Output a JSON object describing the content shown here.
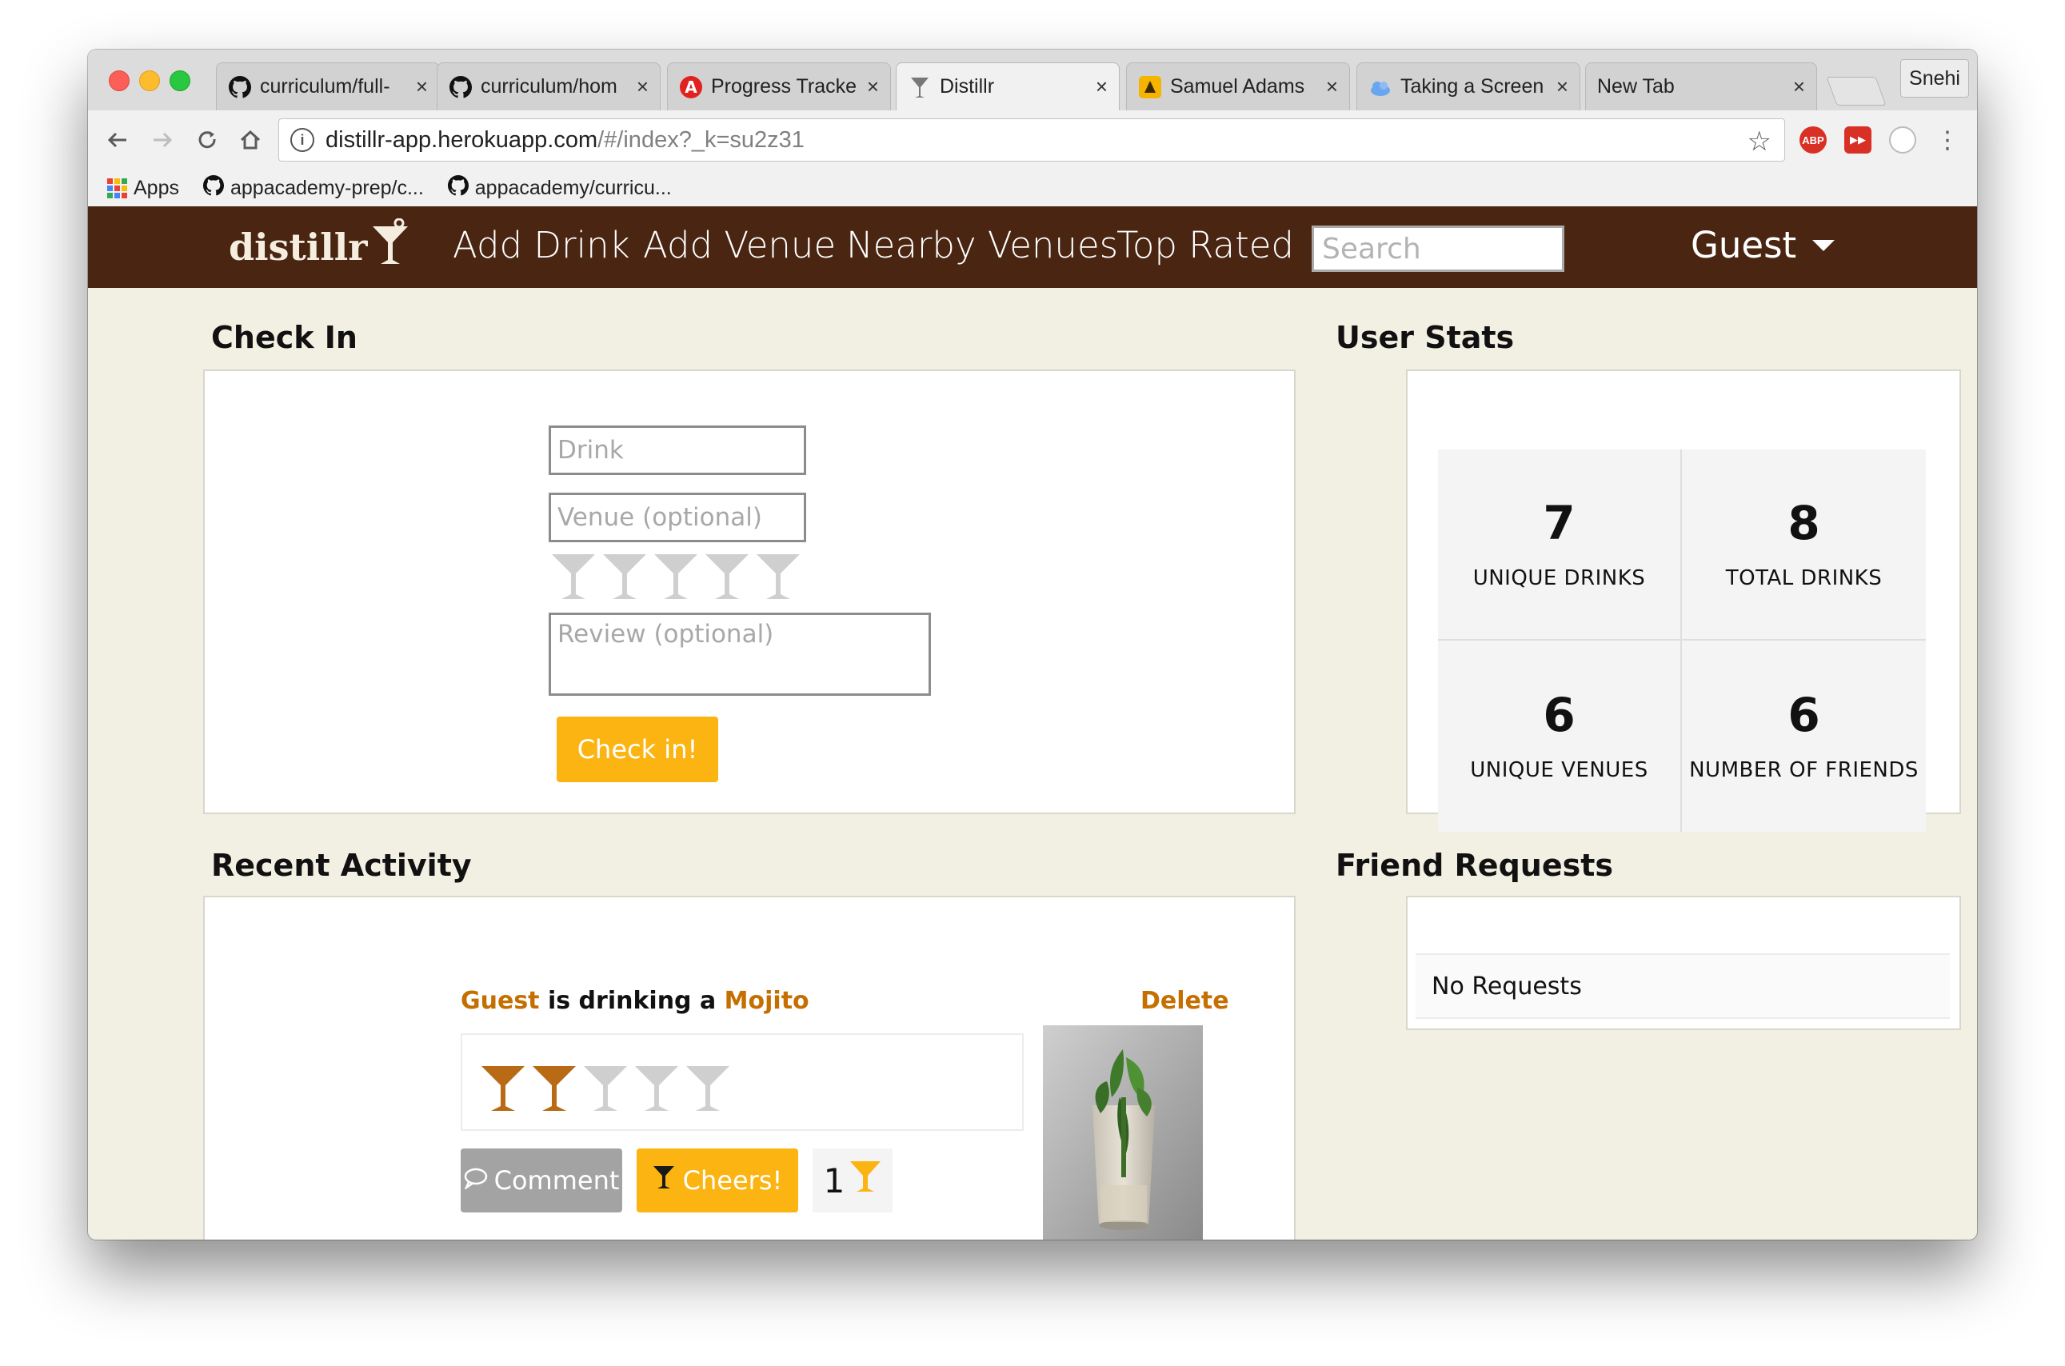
{
  "browser": {
    "tabs": [
      {
        "label": "curriculum/full-",
        "icon": "github-icon"
      },
      {
        "label": "curriculum/hom",
        "icon": "github-icon"
      },
      {
        "label": "Progress Tracke",
        "icon": "angular-icon"
      },
      {
        "label": "Distillr",
        "icon": "martini-icon"
      },
      {
        "label": "Samuel Adams",
        "icon": "yelp-icon"
      },
      {
        "label": "Taking a Screen",
        "icon": "cloud-icon"
      },
      {
        "label": "New Tab",
        "icon": ""
      }
    ],
    "close_glyph": "×",
    "profile": "Snehi",
    "url_host": "distillr-app.herokuapp.com",
    "url_path": "/#/index?_k=su2z31",
    "bookmarks": [
      {
        "label": "Apps",
        "icon": "apps-grid-icon"
      },
      {
        "label": "appacademy-prep/c...",
        "icon": "github-icon"
      },
      {
        "label": "appacademy/curricu...",
        "icon": "github-icon"
      }
    ],
    "extensions": [
      {
        "label": "ABP",
        "color": "#d93025"
      },
      {
        "label": "▶▶",
        "color": "#d93025"
      }
    ]
  },
  "site": {
    "logo": "distillr",
    "nav": [
      "Add Drink",
      "Add Venue",
      "Nearby Venues",
      "Top Rated"
    ],
    "search_placeholder": "Search",
    "user_menu": "Guest",
    "colors": {
      "header": "#4a2612",
      "accent": "#fbb411",
      "link": "#c56f00",
      "background": "#f2efe3"
    }
  },
  "checkin": {
    "title": "Check In",
    "drink_placeholder": "Drink",
    "venue_placeholder": "Venue (optional)",
    "rating": 0,
    "rating_max": 5,
    "review_placeholder": "Review (optional)",
    "submit_label": "Check in!"
  },
  "stats": {
    "title": "User Stats",
    "items": [
      {
        "value": "7",
        "label": "UNIQUE DRINKS"
      },
      {
        "value": "8",
        "label": "TOTAL DRINKS"
      },
      {
        "value": "6",
        "label": "UNIQUE VENUES"
      },
      {
        "value": "6",
        "label": "NUMBER OF FRIENDS"
      }
    ]
  },
  "activity": {
    "title": "Recent Activity",
    "items": [
      {
        "user": "Guest",
        "middle": " is drinking a ",
        "drink": "Mojito",
        "delete_label": "Delete",
        "rating": 2,
        "rating_max": 5,
        "comment_label": "Comment",
        "cheers_label": "Cheers!",
        "cheers_count": "1"
      }
    ]
  },
  "friend_requests": {
    "title": "Friend Requests",
    "empty_text": "No Requests"
  }
}
